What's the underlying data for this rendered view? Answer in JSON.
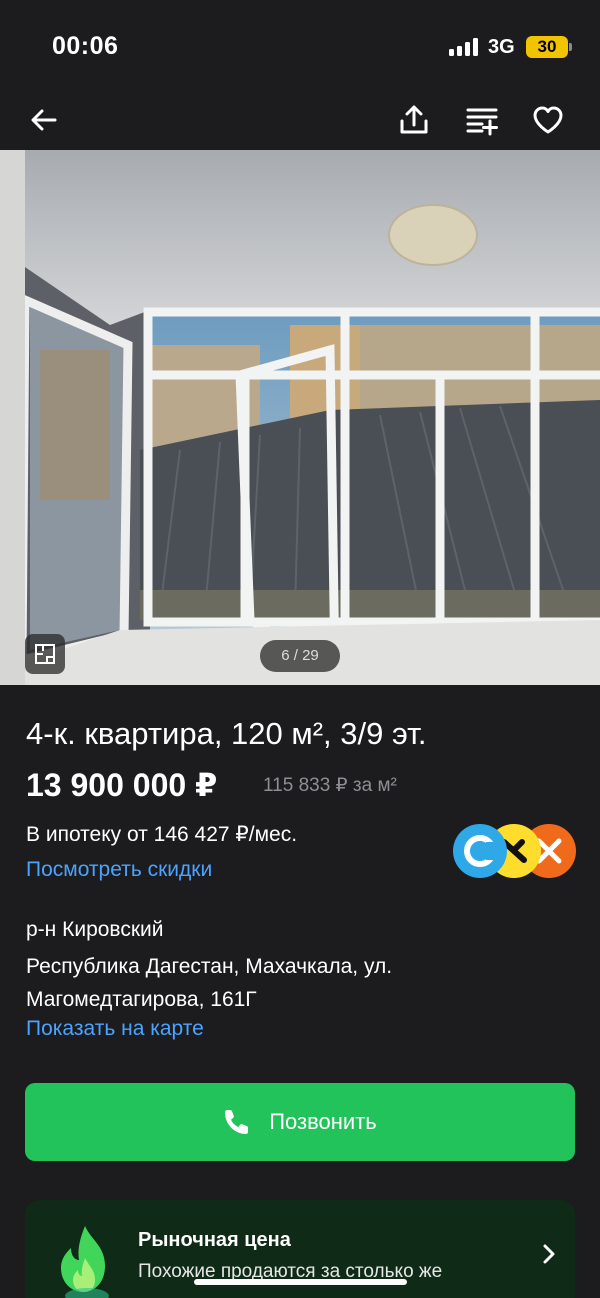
{
  "status_bar": {
    "time": "00:06",
    "network": "3G",
    "battery": "30"
  },
  "gallery": {
    "counter": "6 / 29"
  },
  "listing": {
    "title": "4-к. квартира, 120 м², 3/9 эт.",
    "price": "13 900 000 ₽",
    "price_per_m2": "115 833 ₽ за м²",
    "mortgage": "В ипотеку от 146 427 ₽/мес.",
    "discounts_link": "Посмотреть скидки",
    "district": "р-н Кировский",
    "address": "Республика Дагестан, Махачкала, ул. Магомедтагирова, 161Г",
    "map_link": "Показать на карте"
  },
  "actions": {
    "call_label": "Позвонить"
  },
  "market_card": {
    "title": "Рыночная цена",
    "subtitle": "Похожие продаются за столько же"
  },
  "colors": {
    "background": "#1c1c1e",
    "link": "#4aa3ff",
    "call_button": "#22c35a",
    "market_card": "#0f2a16",
    "battery": "#f2c400"
  },
  "icons": [
    "back-arrow-icon",
    "share-icon",
    "compare-icon",
    "heart-icon",
    "floor-plan-icon",
    "phone-icon",
    "flame-icon",
    "chevron-right-icon"
  ]
}
